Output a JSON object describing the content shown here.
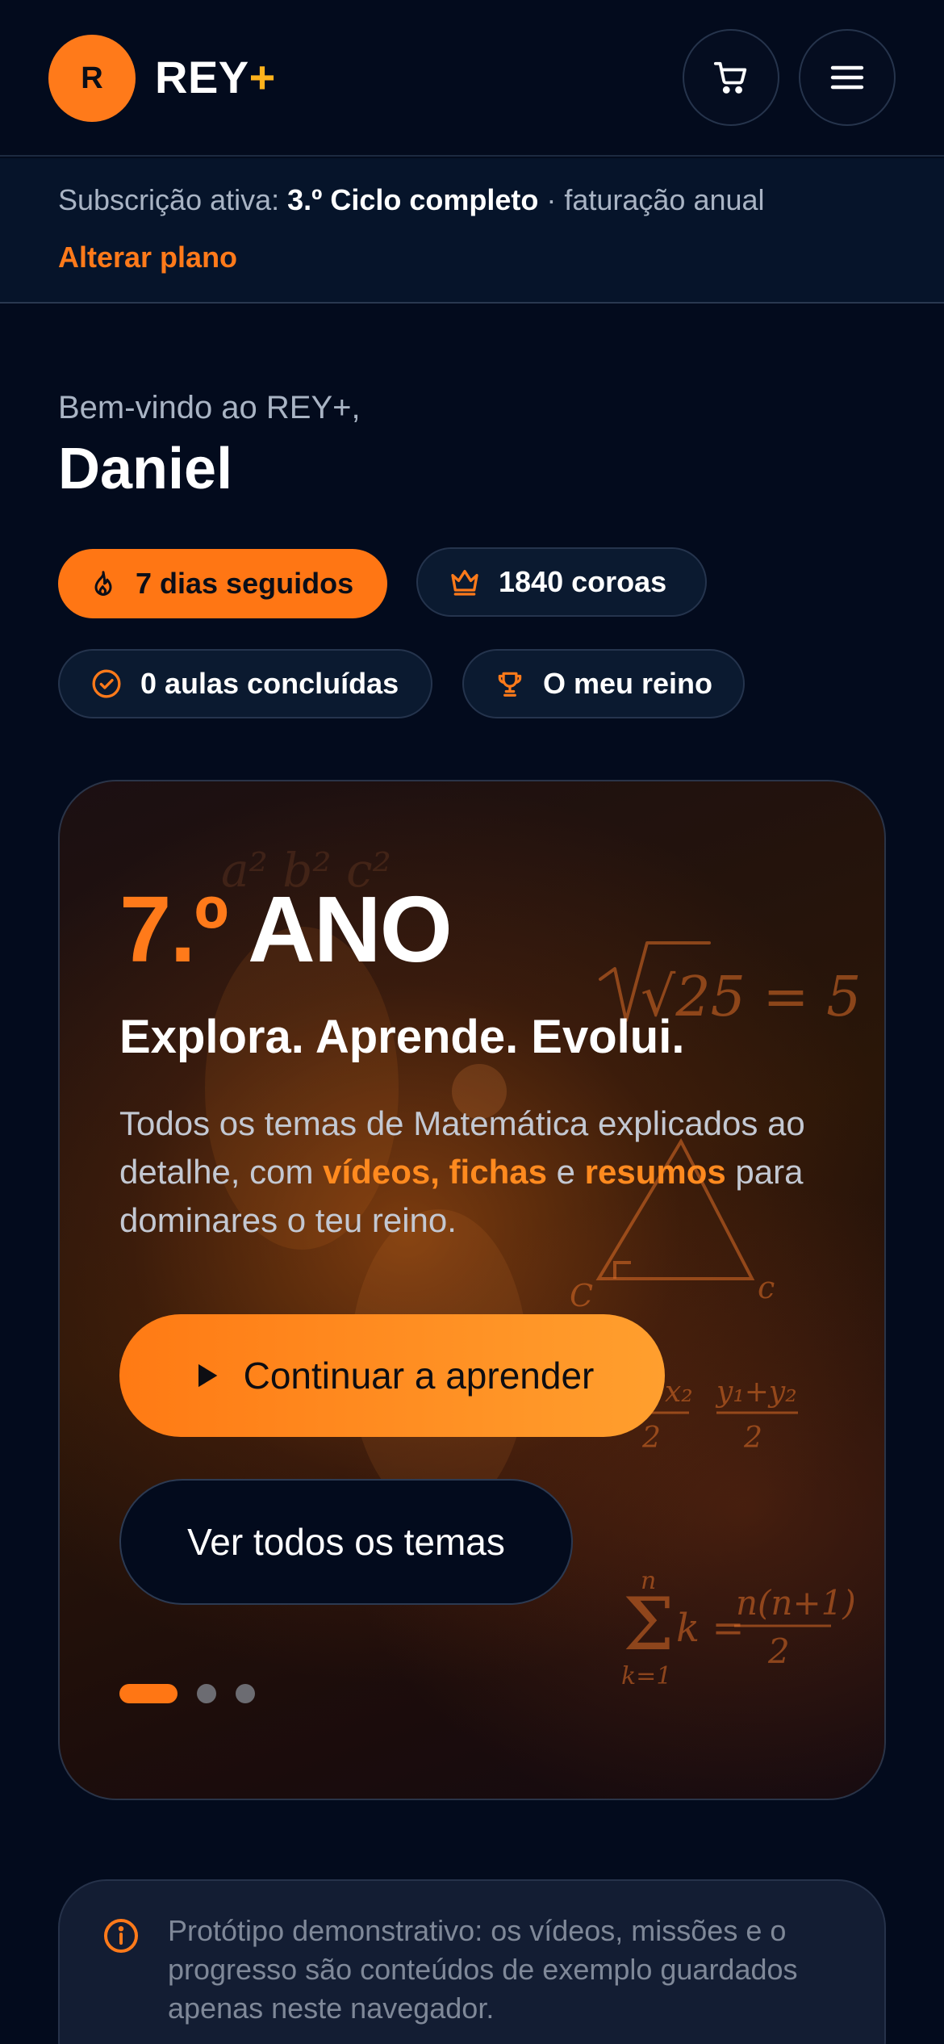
{
  "header": {
    "logo_letter": "R",
    "brand_name": "REY",
    "brand_plus": "+",
    "cart_icon": "cart-icon",
    "menu_icon": "menu-icon"
  },
  "subscription": {
    "prefix": "Subscrição ativa: ",
    "plan": "3.º Ciclo completo",
    "suffix": " · faturação anual",
    "change_plan_label": "Alterar plano"
  },
  "welcome": {
    "greeting": "Bem-vindo ao REY+,",
    "name": "Daniel"
  },
  "stats": {
    "streak": {
      "label": "7 dias seguidos",
      "icon": "flame-icon"
    },
    "crowns": {
      "label": "1840 coroas",
      "icon": "crown-icon"
    },
    "lessons": {
      "label": "0 aulas concluídas",
      "icon": "check-circle-icon"
    },
    "kingdom": {
      "label": "O meu reino",
      "icon": "trophy-icon"
    }
  },
  "hero": {
    "grade_number": "7.º",
    "grade_word": " ANO",
    "tagline": "Explora. Aprende. Evolui.",
    "desc_1": "Todos os temas de Matemática explicados ao detalhe, com ",
    "desc_hl_1": "vídeos, fichas",
    "desc_2": " e ",
    "desc_hl_2": "resumos",
    "desc_3": " para dominares o teu reino.",
    "primary_cta": "Continuar a aprender",
    "secondary_cta": "Ver todos os temas",
    "slide_count": 3,
    "active_slide": 1,
    "math_decor": [
      "√25 = 5",
      "C",
      "c",
      "x₂",
      "y₁+y₂",
      "2",
      "n",
      "k =",
      "n(n+1)",
      "k=1"
    ]
  },
  "notice": {
    "icon": "info-icon",
    "text": "Protótipo demonstrativo: os vídeos, missões e o progresso são conteúdos de exemplo guardados apenas neste navegador."
  },
  "colors": {
    "background": "#030b1d",
    "accent": "#ff7a1a",
    "brand_plus": "#ffb21c",
    "muted_text": "#a9b4c4"
  }
}
